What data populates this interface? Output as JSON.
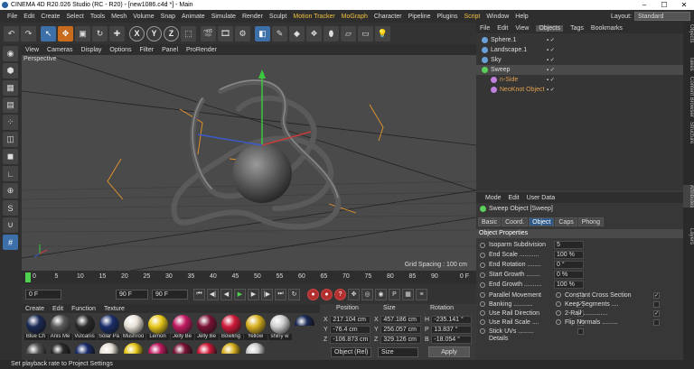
{
  "window": {
    "title": "CINEMA 4D R20.026 Studio (RC - R20) - [new1086.c4d *] - Main",
    "min": "–",
    "max": "☐",
    "close": "✕"
  },
  "menu": [
    "File",
    "Edit",
    "Create",
    "Select",
    "Tools",
    "Mesh",
    "Volume",
    "Snap",
    "Animate",
    "Simulate",
    "Render",
    "Sculpt",
    "Motion Tracker",
    "MoGraph",
    "Character",
    "Pipeline",
    "Plugins",
    "Script",
    "Window",
    "Help"
  ],
  "layout": {
    "label": "Layout:",
    "value": "Standard"
  },
  "viewport": {
    "menu": [
      "View",
      "Cameras",
      "Display",
      "Options",
      "Filter",
      "Panel",
      "ProRender"
    ],
    "camera_label": "Perspective",
    "grid_spacing": "Grid Spacing : 100 cm"
  },
  "timeline": {
    "ticks": [
      "0",
      "5",
      "10",
      "15",
      "20",
      "25",
      "30",
      "35",
      "40",
      "45",
      "50",
      "55",
      "60",
      "65",
      "70",
      "75",
      "80",
      "85",
      "90"
    ],
    "end_marker": "0 F"
  },
  "frames": {
    "start": "0 F",
    "mid": "0 F",
    "end_a": "90 F",
    "end_b": "90 F"
  },
  "materials": {
    "menu": [
      "Create",
      "Edit",
      "Function",
      "Texture"
    ],
    "items": [
      {
        "label": "Blue Ch",
        "color": "#1a2a55"
      },
      {
        "label": "Anis Me",
        "color": "#5a5a5a"
      },
      {
        "label": "Vulcanis",
        "color": "#2a2a2a"
      },
      {
        "label": "Solar Pa",
        "color": "#1b2d6b"
      },
      {
        "label": "Mushroo",
        "color": "#e8e2d8"
      },
      {
        "label": "Lemon",
        "color": "#e8c81a"
      },
      {
        "label": "Jelly Be",
        "color": "#c01a60"
      },
      {
        "label": "Jelly Be",
        "color": "#7a1235"
      },
      {
        "label": "Bowling",
        "color": "#d01a3a"
      },
      {
        "label": "Yellow",
        "color": "#d8b020"
      },
      {
        "label": "shiny w",
        "color": "#cfcfcf"
      }
    ]
  },
  "coords": {
    "headers": [
      "Position",
      "Size",
      "Rotation"
    ],
    "rows": [
      {
        "axis": "X",
        "pos": "217.104 cm",
        "axis2": "X",
        "size": "457.186 cm",
        "axis3": "H",
        "rot": "-235.141 °"
      },
      {
        "axis": "Y",
        "pos": "-76.4 cm",
        "axis2": "Y",
        "size": "256.057 cm",
        "axis3": "P",
        "rot": "13.837 °"
      },
      {
        "axis": "Z",
        "pos": "-106.873 cm",
        "axis2": "Z",
        "size": "329.126 cm",
        "axis3": "B",
        "rot": "-18.054 °"
      }
    ],
    "mode1": "Object (Rel)",
    "mode2": "Size",
    "apply": "Apply"
  },
  "status": "Set playback rate to Project Settings",
  "objects": {
    "tabs": [
      "File",
      "Edit",
      "View",
      "Objects",
      "Tags",
      "Bookmarks"
    ],
    "items": [
      {
        "name": "Sphere.1",
        "color": "#6aa0d8",
        "indent": 0
      },
      {
        "name": "Landscape.1",
        "color": "#6aa0d8",
        "indent": 0
      },
      {
        "name": "Sky",
        "color": "#6aa0d8",
        "indent": 0
      },
      {
        "name": "Sweep",
        "color": "#5ad05a",
        "indent": 0
      },
      {
        "name": "n-Side",
        "color": "#c080e0",
        "indent": 1
      },
      {
        "name": "NeoKnot Object",
        "color": "#c080e0",
        "indent": 1
      }
    ]
  },
  "attributes": {
    "menu": [
      "Mode",
      "Edit",
      "User Data"
    ],
    "title": "Sweep Object [Sweep]",
    "tabs": [
      "Basic",
      "Coord.",
      "Object",
      "Caps",
      "Phong"
    ],
    "section": "Object Properties",
    "props": [
      {
        "label": "Isoparm Subdivision",
        "value": "5"
      },
      {
        "label": "End Scale ...........",
        "value": "100 %"
      },
      {
        "label": "End Rotation ........",
        "value": "0 °"
      },
      {
        "label": "Start Growth ........",
        "value": "0 %"
      },
      {
        "label": "End Growth ..........",
        "value": "100 %"
      }
    ],
    "checks": [
      {
        "label": "Parallel Movement",
        "checked": ""
      },
      {
        "label": "Banking ...........",
        "checked": "✓"
      },
      {
        "label": "Use Rail Direction",
        "checked": "✓"
      },
      {
        "label": "Use Rail Scale ....",
        "checked": "✓"
      },
      {
        "label": "Stick UVs .........",
        "checked": ""
      }
    ],
    "checks2": [
      {
        "label": "Constant Cross Section",
        "checked": "✓"
      },
      {
        "label": "Keep Segments ....",
        "checked": ""
      },
      {
        "label": "2-Rail ..............",
        "checked": "✓"
      },
      {
        "label": "Flip Normals .........",
        "checked": ""
      }
    ],
    "details": "Details"
  },
  "sidetabs": [
    "Objects",
    "Takes",
    "Content Browser",
    "Structure",
    "Attributes",
    "Layers"
  ]
}
